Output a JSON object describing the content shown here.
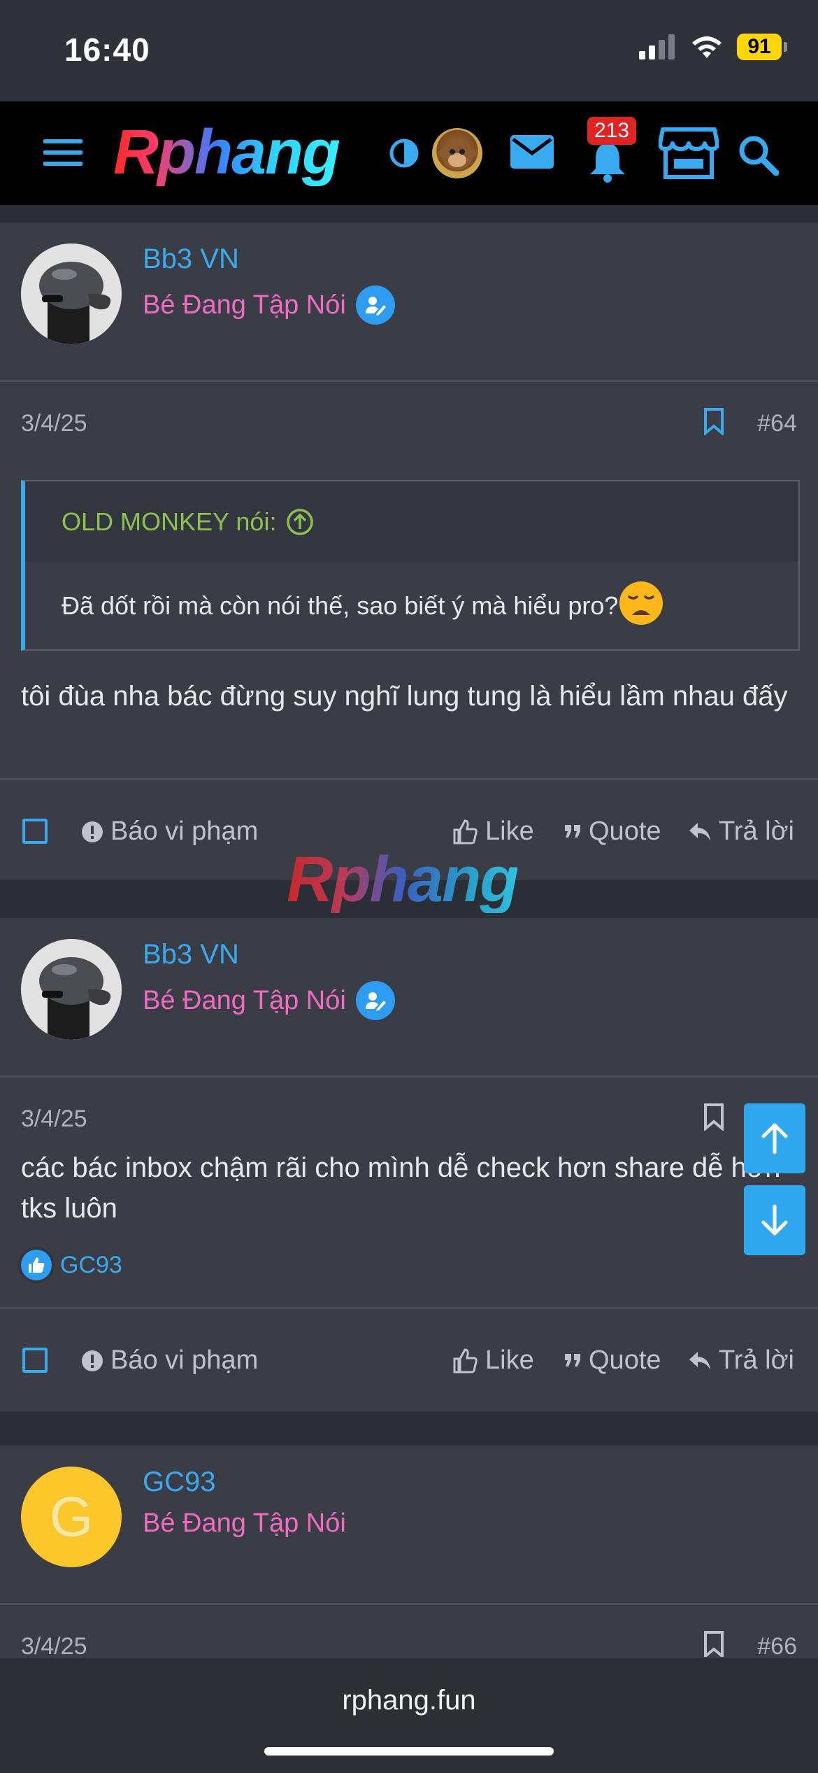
{
  "status_bar": {
    "time": "16:40",
    "battery": "91"
  },
  "navbar": {
    "logo": "Rphang",
    "notifications_count": "213"
  },
  "posts": [
    {
      "author": "Bb3 VN",
      "user_title": "Bé Đang Tập Nói",
      "date": "3/4/25",
      "post_number": "#64",
      "quote": {
        "author_line": "OLD MONKEY nói:",
        "text": "Đã dốt rồi mà còn nói thế, sao biết ý mà hiểu pro?"
      },
      "message": "tôi đùa nha bác đừng suy nghĩ lung tung là hiểu lầm nhau đấy"
    },
    {
      "author": "Bb3 VN",
      "user_title": "Bé Đang Tập Nói",
      "date": "3/4/25",
      "post_number": "",
      "message": "các bác inbox chậm rãi cho mình dễ check hơn share dễ hơn tks luôn",
      "liked_by": "GC93"
    },
    {
      "author": "GC93",
      "avatar_letter": "G",
      "user_title": "Bé Đang Tập Nói",
      "date": "3/4/25",
      "post_number": "#66"
    }
  ],
  "actions": {
    "report": "Báo vi phạm",
    "like": "Like",
    "quote": "Quote",
    "reply": "Trả lời"
  },
  "watermark": "Rphang",
  "browser": {
    "url": "rphang.fun"
  }
}
